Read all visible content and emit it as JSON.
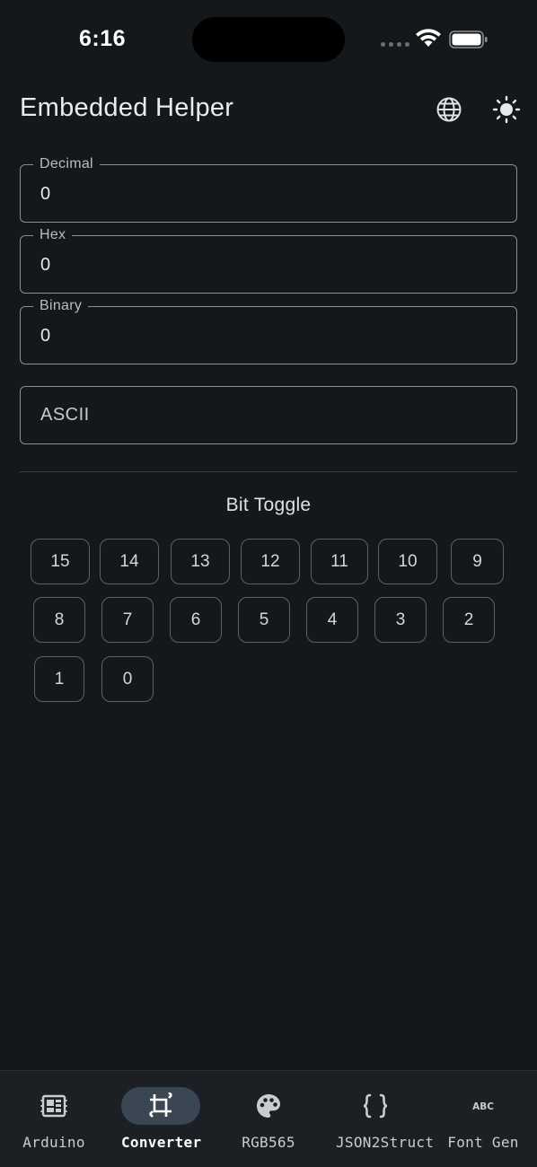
{
  "status_bar": {
    "time": "6:16"
  },
  "app_bar": {
    "title": "Embedded Helper",
    "language_icon": "globe-icon",
    "theme_icon": "sun-icon"
  },
  "converter": {
    "decimal": {
      "label": "Decimal",
      "value": "0"
    },
    "hex": {
      "label": "Hex",
      "value": "0"
    },
    "binary": {
      "label": "Binary",
      "value": "0"
    },
    "ascii": {
      "placeholder": "ASCII",
      "value": ""
    }
  },
  "bit_toggle": {
    "title": "Bit Toggle",
    "bits": [
      "15",
      "14",
      "13",
      "12",
      "11",
      "10",
      "9",
      "8",
      "7",
      "6",
      "5",
      "4",
      "3",
      "2",
      "1",
      "0"
    ]
  },
  "bottom_nav": {
    "items": [
      {
        "label": "Arduino",
        "icon": "board-icon"
      },
      {
        "label": "Converter",
        "icon": "crop-icon",
        "active": true
      },
      {
        "label": "RGB565",
        "icon": "palette-icon"
      },
      {
        "label": "JSON2Struct",
        "icon": "braces-icon"
      },
      {
        "label": "Font Gen",
        "icon": "abc-icon"
      }
    ]
  },
  "colors": {
    "background": "#15181b",
    "nav_background": "#1c1f23",
    "active_pill": "#3b4654",
    "outline": "#8a8e93"
  }
}
